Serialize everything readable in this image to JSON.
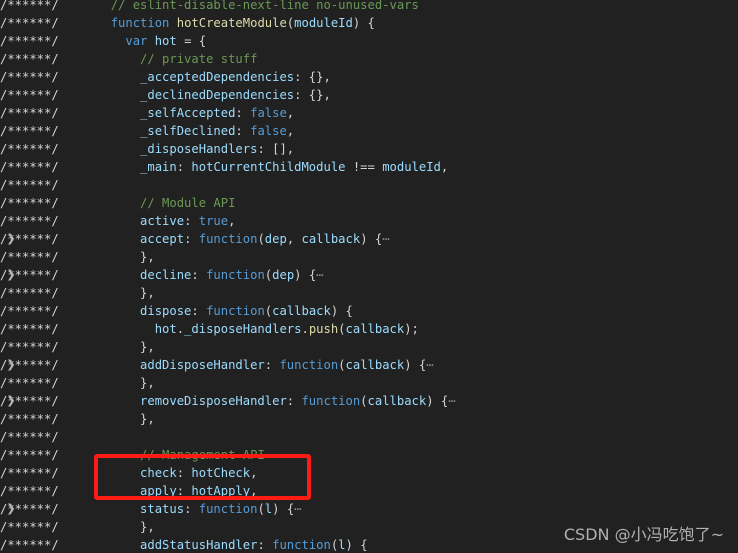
{
  "editor": {
    "background_color": "#212121",
    "gutter_prefix": "/******/",
    "fold_chevron": "❯",
    "fold_ellipsis": "⋯",
    "colors": {
      "background": "#212121",
      "default_text": "#d4d4d4",
      "comment": "#6a9955",
      "keyword": "#569cd6",
      "function_name": "#dcdcaa",
      "variable": "#9cdcfe",
      "annotation_red": "#fc1c14",
      "watermark": "#bdbdbd"
    }
  },
  "annotation": {
    "type": "rectangle-highlight",
    "color": "#fc1c14",
    "highlighted_lines": [
      "check: hotCheck,",
      "apply: hotApply,"
    ]
  },
  "watermark": {
    "text": "CSDN @小冯吃饱了~"
  },
  "lines": [
    {
      "fold": false,
      "prefix": "/******/",
      "tokens": [
        {
          "t": "  ",
          "c": "t-def"
        },
        {
          "t": "// eslint-disable-next-line no-unused-vars",
          "c": "t-com"
        }
      ]
    },
    {
      "fold": false,
      "prefix": "/******/",
      "tokens": [
        {
          "t": "  ",
          "c": "t-def"
        },
        {
          "t": "function ",
          "c": "t-kw"
        },
        {
          "t": "hotCreateModule",
          "c": "t-fn"
        },
        {
          "t": "(",
          "c": "t-punc"
        },
        {
          "t": "moduleId",
          "c": "t-var"
        },
        {
          "t": ") {",
          "c": "t-punc"
        }
      ]
    },
    {
      "fold": false,
      "prefix": "/******/",
      "tokens": [
        {
          "t": "    ",
          "c": "t-def"
        },
        {
          "t": "var ",
          "c": "t-kw"
        },
        {
          "t": "hot",
          "c": "t-var"
        },
        {
          "t": " = {",
          "c": "t-punc"
        }
      ]
    },
    {
      "fold": false,
      "prefix": "/******/",
      "tokens": [
        {
          "t": "      ",
          "c": "t-def"
        },
        {
          "t": "// private stuff",
          "c": "t-com"
        }
      ]
    },
    {
      "fold": false,
      "prefix": "/******/",
      "tokens": [
        {
          "t": "      ",
          "c": "t-def"
        },
        {
          "t": "_acceptedDependencies",
          "c": "t-var"
        },
        {
          "t": ": {},",
          "c": "t-punc"
        }
      ]
    },
    {
      "fold": false,
      "prefix": "/******/",
      "tokens": [
        {
          "t": "      ",
          "c": "t-def"
        },
        {
          "t": "_declinedDependencies",
          "c": "t-var"
        },
        {
          "t": ": {},",
          "c": "t-punc"
        }
      ]
    },
    {
      "fold": false,
      "prefix": "/******/",
      "tokens": [
        {
          "t": "      ",
          "c": "t-def"
        },
        {
          "t": "_selfAccepted",
          "c": "t-var"
        },
        {
          "t": ": ",
          "c": "t-punc"
        },
        {
          "t": "false",
          "c": "t-kw"
        },
        {
          "t": ",",
          "c": "t-punc"
        }
      ]
    },
    {
      "fold": false,
      "prefix": "/******/",
      "tokens": [
        {
          "t": "      ",
          "c": "t-def"
        },
        {
          "t": "_selfDeclined",
          "c": "t-var"
        },
        {
          "t": ": ",
          "c": "t-punc"
        },
        {
          "t": "false",
          "c": "t-kw"
        },
        {
          "t": ",",
          "c": "t-punc"
        }
      ]
    },
    {
      "fold": false,
      "prefix": "/******/",
      "tokens": [
        {
          "t": "      ",
          "c": "t-def"
        },
        {
          "t": "_disposeHandlers",
          "c": "t-var"
        },
        {
          "t": ": [],",
          "c": "t-punc"
        }
      ]
    },
    {
      "fold": false,
      "prefix": "/******/",
      "tokens": [
        {
          "t": "      ",
          "c": "t-def"
        },
        {
          "t": "_main",
          "c": "t-var"
        },
        {
          "t": ": ",
          "c": "t-punc"
        },
        {
          "t": "hotCurrentChildModule",
          "c": "t-var"
        },
        {
          "t": " !== ",
          "c": "t-punc"
        },
        {
          "t": "moduleId",
          "c": "t-var"
        },
        {
          "t": ",",
          "c": "t-punc"
        }
      ]
    },
    {
      "fold": false,
      "prefix": "/******/",
      "tokens": []
    },
    {
      "fold": false,
      "prefix": "/******/",
      "tokens": [
        {
          "t": "      ",
          "c": "t-def"
        },
        {
          "t": "// Module API",
          "c": "t-com"
        }
      ]
    },
    {
      "fold": false,
      "prefix": "/******/",
      "tokens": [
        {
          "t": "      ",
          "c": "t-def"
        },
        {
          "t": "active",
          "c": "t-var"
        },
        {
          "t": ": ",
          "c": "t-punc"
        },
        {
          "t": "true",
          "c": "t-kw"
        },
        {
          "t": ",",
          "c": "t-punc"
        }
      ]
    },
    {
      "fold": true,
      "prefix": "/******/",
      "tokens": [
        {
          "t": "      ",
          "c": "t-def"
        },
        {
          "t": "accept",
          "c": "t-var"
        },
        {
          "t": ": ",
          "c": "t-punc"
        },
        {
          "t": "function",
          "c": "t-kw"
        },
        {
          "t": "(",
          "c": "t-punc"
        },
        {
          "t": "dep",
          "c": "t-var"
        },
        {
          "t": ", ",
          "c": "t-punc"
        },
        {
          "t": "callback",
          "c": "t-var"
        },
        {
          "t": ") {",
          "c": "t-punc"
        },
        {
          "t": "⋯",
          "c": "t-ellip"
        }
      ]
    },
    {
      "fold": false,
      "prefix": "/******/",
      "tokens": [
        {
          "t": "      },",
          "c": "t-punc"
        }
      ]
    },
    {
      "fold": true,
      "prefix": "/******/",
      "tokens": [
        {
          "t": "      ",
          "c": "t-def"
        },
        {
          "t": "decline",
          "c": "t-var"
        },
        {
          "t": ": ",
          "c": "t-punc"
        },
        {
          "t": "function",
          "c": "t-kw"
        },
        {
          "t": "(",
          "c": "t-punc"
        },
        {
          "t": "dep",
          "c": "t-var"
        },
        {
          "t": ") {",
          "c": "t-punc"
        },
        {
          "t": "⋯",
          "c": "t-ellip"
        }
      ]
    },
    {
      "fold": false,
      "prefix": "/******/",
      "tokens": [
        {
          "t": "      },",
          "c": "t-punc"
        }
      ]
    },
    {
      "fold": false,
      "prefix": "/******/",
      "tokens": [
        {
          "t": "      ",
          "c": "t-def"
        },
        {
          "t": "dispose",
          "c": "t-var"
        },
        {
          "t": ": ",
          "c": "t-punc"
        },
        {
          "t": "function",
          "c": "t-kw"
        },
        {
          "t": "(",
          "c": "t-punc"
        },
        {
          "t": "callback",
          "c": "t-var"
        },
        {
          "t": ") {",
          "c": "t-punc"
        }
      ]
    },
    {
      "fold": false,
      "prefix": "/******/",
      "tokens": [
        {
          "t": "        ",
          "c": "t-def"
        },
        {
          "t": "hot",
          "c": "t-var"
        },
        {
          "t": ".",
          "c": "t-punc"
        },
        {
          "t": "_disposeHandlers",
          "c": "t-var"
        },
        {
          "t": ".",
          "c": "t-punc"
        },
        {
          "t": "push",
          "c": "t-fn"
        },
        {
          "t": "(",
          "c": "t-punc"
        },
        {
          "t": "callback",
          "c": "t-var"
        },
        {
          "t": ");",
          "c": "t-punc"
        }
      ]
    },
    {
      "fold": false,
      "prefix": "/******/",
      "tokens": [
        {
          "t": "      },",
          "c": "t-punc"
        }
      ]
    },
    {
      "fold": true,
      "prefix": "/******/",
      "tokens": [
        {
          "t": "      ",
          "c": "t-def"
        },
        {
          "t": "addDisposeHandler",
          "c": "t-var"
        },
        {
          "t": ": ",
          "c": "t-punc"
        },
        {
          "t": "function",
          "c": "t-kw"
        },
        {
          "t": "(",
          "c": "t-punc"
        },
        {
          "t": "callback",
          "c": "t-var"
        },
        {
          "t": ") {",
          "c": "t-punc"
        },
        {
          "t": "⋯",
          "c": "t-ellip"
        }
      ]
    },
    {
      "fold": false,
      "prefix": "/******/",
      "tokens": [
        {
          "t": "      },",
          "c": "t-punc"
        }
      ]
    },
    {
      "fold": true,
      "prefix": "/******/",
      "tokens": [
        {
          "t": "      ",
          "c": "t-def"
        },
        {
          "t": "removeDisposeHandler",
          "c": "t-var"
        },
        {
          "t": ": ",
          "c": "t-punc"
        },
        {
          "t": "function",
          "c": "t-kw"
        },
        {
          "t": "(",
          "c": "t-punc"
        },
        {
          "t": "callback",
          "c": "t-var"
        },
        {
          "t": ") {",
          "c": "t-punc"
        },
        {
          "t": "⋯",
          "c": "t-ellip"
        }
      ]
    },
    {
      "fold": false,
      "prefix": "/******/",
      "tokens": [
        {
          "t": "      },",
          "c": "t-punc"
        }
      ]
    },
    {
      "fold": false,
      "prefix": "/******/",
      "tokens": []
    },
    {
      "fold": false,
      "prefix": "/******/",
      "tokens": [
        {
          "t": "      ",
          "c": "t-def"
        },
        {
          "t": "// Management API",
          "c": "t-com"
        }
      ]
    },
    {
      "fold": false,
      "prefix": "/******/",
      "tokens": [
        {
          "t": "      ",
          "c": "t-def"
        },
        {
          "t": "check",
          "c": "t-var"
        },
        {
          "t": ": ",
          "c": "t-punc"
        },
        {
          "t": "hotCheck",
          "c": "t-var"
        },
        {
          "t": ",",
          "c": "t-punc"
        }
      ]
    },
    {
      "fold": false,
      "prefix": "/******/",
      "tokens": [
        {
          "t": "      ",
          "c": "t-def"
        },
        {
          "t": "apply",
          "c": "t-var"
        },
        {
          "t": ": ",
          "c": "t-punc"
        },
        {
          "t": "hotApply",
          "c": "t-var"
        },
        {
          "t": ",",
          "c": "t-punc"
        }
      ]
    },
    {
      "fold": true,
      "prefix": "/******/",
      "tokens": [
        {
          "t": "      ",
          "c": "t-def"
        },
        {
          "t": "status",
          "c": "t-var"
        },
        {
          "t": ": ",
          "c": "t-punc"
        },
        {
          "t": "function",
          "c": "t-kw"
        },
        {
          "t": "(",
          "c": "t-punc"
        },
        {
          "t": "l",
          "c": "t-var"
        },
        {
          "t": ") {",
          "c": "t-punc"
        },
        {
          "t": "⋯",
          "c": "t-ellip"
        }
      ]
    },
    {
      "fold": false,
      "prefix": "/******/",
      "tokens": [
        {
          "t": "      },",
          "c": "t-punc"
        }
      ]
    },
    {
      "fold": false,
      "prefix": "/******/",
      "tokens": [
        {
          "t": "      ",
          "c": "t-def"
        },
        {
          "t": "addStatusHandler",
          "c": "t-var"
        },
        {
          "t": ": ",
          "c": "t-punc"
        },
        {
          "t": "function",
          "c": "t-kw"
        },
        {
          "t": "(",
          "c": "t-punc"
        },
        {
          "t": "l",
          "c": "t-var"
        },
        {
          "t": ") {",
          "c": "t-punc"
        }
      ]
    }
  ]
}
